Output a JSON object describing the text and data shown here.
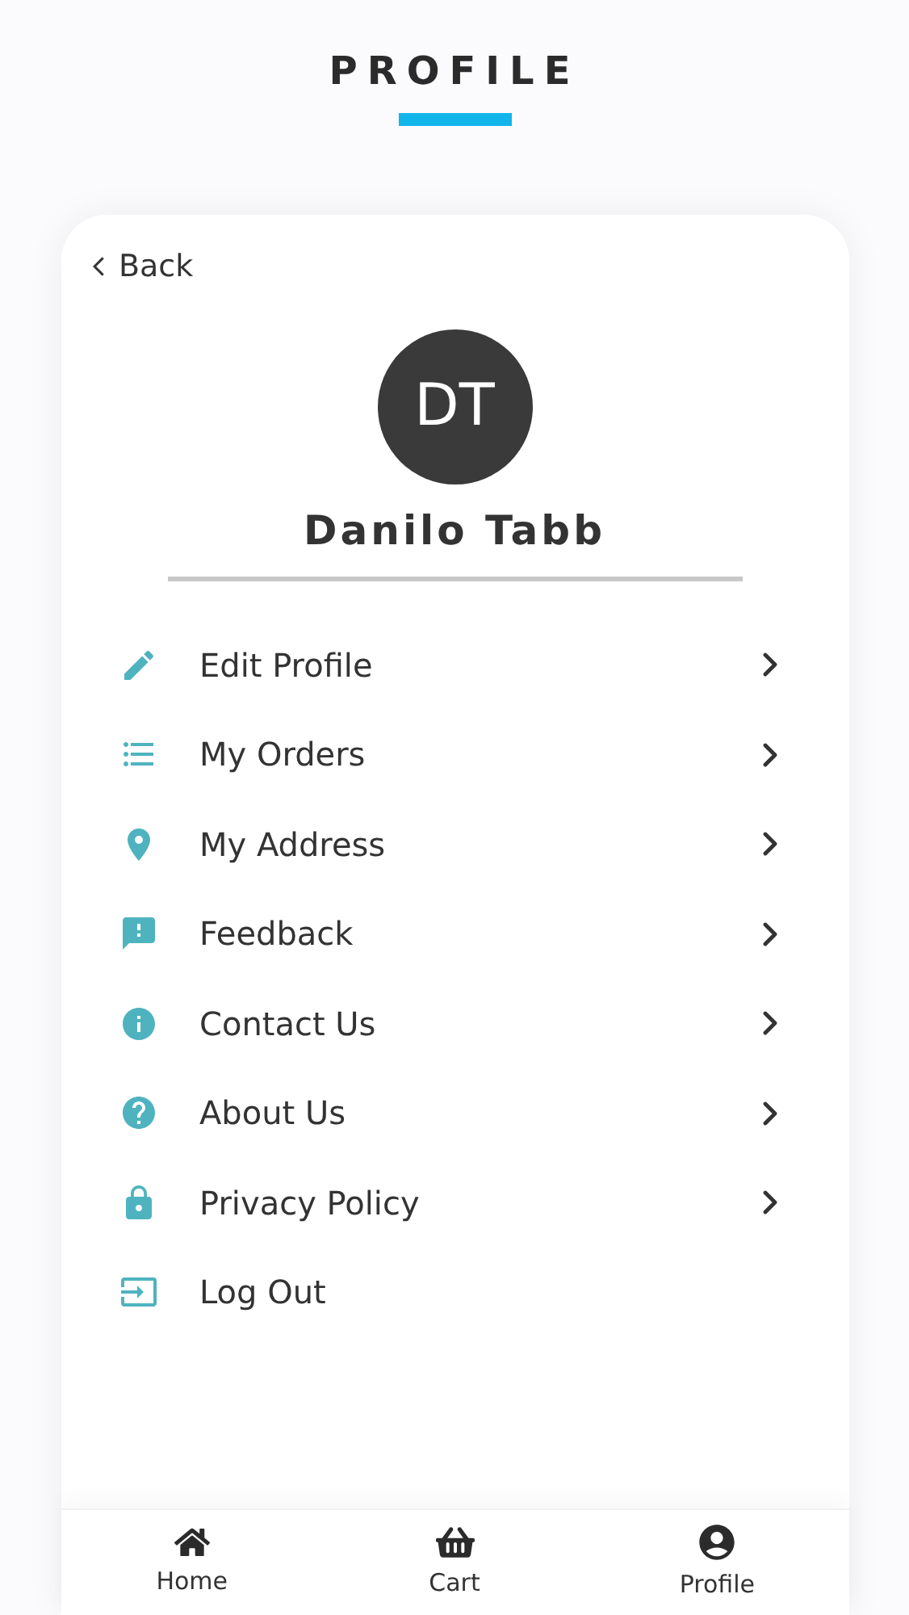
{
  "header": {
    "title": "PROFILE"
  },
  "back": {
    "label": "Back"
  },
  "user": {
    "initials": "DT",
    "name": "Danilo Tabb"
  },
  "menu": [
    {
      "label": "Edit Profile",
      "kind": "edit",
      "chevron": true
    },
    {
      "label": "My Orders",
      "kind": "orders",
      "chevron": true
    },
    {
      "label": "My Address",
      "kind": "address",
      "chevron": true
    },
    {
      "label": "Feedback",
      "kind": "feedback",
      "chevron": true
    },
    {
      "label": "Contact Us",
      "kind": "contact",
      "chevron": true
    },
    {
      "label": "About Us",
      "kind": "about",
      "chevron": true
    },
    {
      "label": "Privacy Policy",
      "kind": "privacy",
      "chevron": true
    },
    {
      "label": "Log Out",
      "kind": "logout",
      "chevron": false
    }
  ],
  "nav": [
    {
      "label": "Home",
      "kind": "home"
    },
    {
      "label": "Cart",
      "kind": "cart"
    },
    {
      "label": "Profile",
      "kind": "profile"
    }
  ]
}
